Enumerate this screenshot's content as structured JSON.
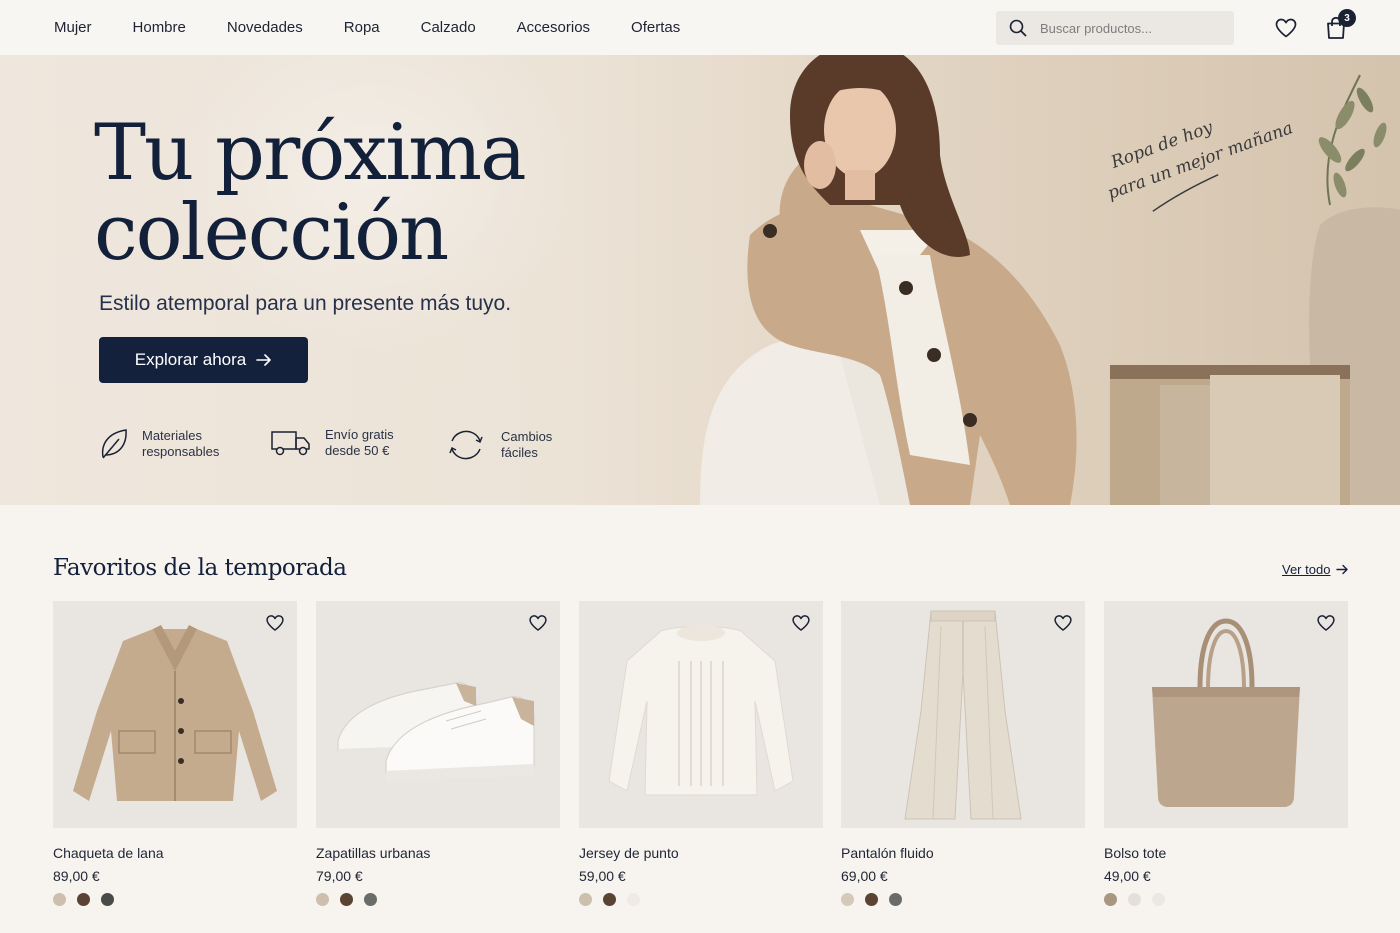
{
  "nav": {
    "links": [
      "Mujer",
      "Hombre",
      "Novedades",
      "Ropa",
      "Calzado",
      "Accesorios",
      "Ofertas"
    ],
    "search_placeholder": "Buscar productos...",
    "cart_count": "3"
  },
  "hero": {
    "title_line1": "Tu próxima",
    "title_line2": "colección",
    "subtitle": "Estilo atemporal para un presente más tuyo.",
    "cta_label": "Explorar ahora",
    "features": [
      {
        "line1": "Materiales",
        "line2": "responsables",
        "icon": "leaf-icon"
      },
      {
        "line1": "Envío gratis",
        "line2": "desde 50 €",
        "icon": "truck-icon"
      },
      {
        "line1": "Cambios",
        "line2": "fáciles",
        "icon": "exchange-icon"
      }
    ],
    "handwritten_line1": "Ropa de hoy",
    "handwritten_line2": "para un mejor mañana"
  },
  "favorites": {
    "title": "Favoritos de la temporada",
    "see_all": "Ver todo",
    "products": [
      {
        "name": "Chaqueta de lana",
        "price": "89,00 €",
        "swatches": [
          "#cdbfae",
          "#5a4332",
          "#4a4a48"
        ]
      },
      {
        "name": "Zapatillas urbanas",
        "price": "79,00 €",
        "swatches": [
          "#cdbfae",
          "#5a4332",
          "#6b6b69"
        ]
      },
      {
        "name": "Jersey de punto",
        "price": "59,00 €",
        "swatches": [
          "#cdbfae",
          "#5a4332",
          "#efeae4"
        ]
      },
      {
        "name": "Pantalón fluido",
        "price": "69,00 €",
        "swatches": [
          "#d5c9ba",
          "#5a4332",
          "#6b6b69"
        ]
      },
      {
        "name": "Bolso tote",
        "price": "49,00 €",
        "swatches": [
          "#a99681",
          "#e4dfd9",
          "#ebe7e2"
        ]
      }
    ]
  }
}
